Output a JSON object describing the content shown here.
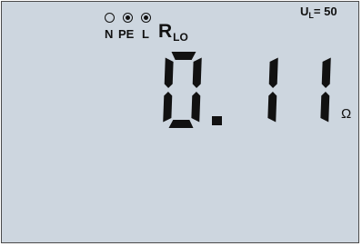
{
  "indicators": [
    {
      "label": "N",
      "state": "off"
    },
    {
      "label": "PE",
      "state": "on"
    },
    {
      "label": "L",
      "state": "on"
    }
  ],
  "function": {
    "main": "R",
    "sub": "LO"
  },
  "voltage": {
    "prefix": "U",
    "sub": "L",
    "value": "= 50"
  },
  "reading": {
    "value": "0.11",
    "unit": "Ω"
  },
  "colors": {
    "lcd_background": "#cdd6df",
    "segment": "#111111"
  }
}
